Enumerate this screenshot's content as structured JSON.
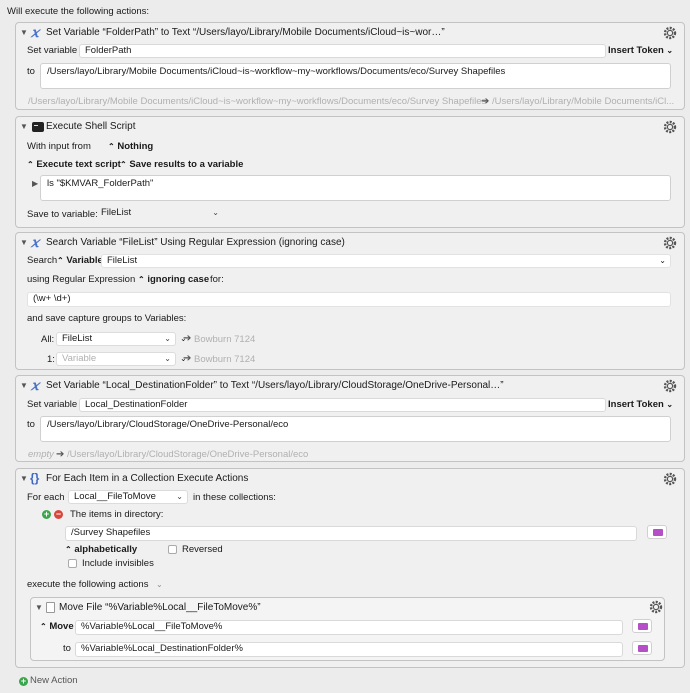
{
  "header": {
    "title": "Will execute the following actions:"
  },
  "a1": {
    "title": "Set Variable “FolderPath” to Text “/Users/layo/Library/Mobile Documents/iCloud~is~wor…”",
    "set_label": "Set variable",
    "var_name": "FolderPath",
    "insert_token": "Insert Token",
    "to_label": "to",
    "value": "/Users/layo/Library/Mobile Documents/iCloud~is~workflow~my~workflows/Documents/eco/Survey Shapefiles",
    "preview_left": "/Users/layo/Library/Mobile Documents/iCloud~is~workflow~my~workflows/Documents/eco/Survey Shapefiles",
    "preview_arrow": "➔",
    "preview_right": "/Users/layo/Library/Mobile Documents/iCl..."
  },
  "a2": {
    "title": "Execute Shell Script",
    "with_input": "With input from",
    "input_value": "Nothing",
    "exec_mode": "Execute text script",
    "save_mode": "Save results to a variable",
    "script": "ls \"$KMVAR_FolderPath\"",
    "save_to_label": "Save to variable:",
    "save_to_value": "FileList"
  },
  "a3": {
    "title": "Search Variable “FileList” Using Regular Expression (ignoring case)",
    "search_label": "Search",
    "search_type": "Variable",
    "search_var": "FileList",
    "using_label": "using Regular Expression",
    "case_mode": "ignoring case",
    "for_label": "for:",
    "regex": "(\\w+ \\d+)",
    "capture_label": "and save capture groups to Variables:",
    "all_label": "All:",
    "all_value": "FileList",
    "all_preview": "Bowburn 7124",
    "g1_label": "1:",
    "g1_placeholder": "Variable",
    "g1_preview": "Bowburn 7124",
    "preview_arrow": "➔"
  },
  "a4": {
    "title": "Set Variable “Local_DestinationFolder” to Text “/Users/layo/Library/CloudStorage/OneDrive-Personal…”",
    "set_label": "Set variable",
    "var_name": "Local_DestinationFolder",
    "insert_token": "Insert Token",
    "to_label": "to",
    "value": "/Users/layo/Library/CloudStorage/OneDrive-Personal/eco",
    "preview_left": "empty",
    "preview_arrow": "➔",
    "preview_right": "/Users/layo/Library/CloudStorage/OneDrive-Personal/eco"
  },
  "a5": {
    "title": "For Each Item in a Collection Execute Actions",
    "for_each_label": "For each",
    "for_each_var": "Local__FileToMove",
    "collections_label": "in these collections:",
    "items_label": "The items in directory:",
    "directory": "/Survey Shapefiles",
    "sort_mode": "alphabetically",
    "reversed_label": "Reversed",
    "include_invisibles": "Include invisibles",
    "execute_label": "execute the following actions",
    "move": {
      "title": "Move File “%Variable%Local__FileToMove%”",
      "mode": "Move",
      "source": "%Variable%Local__FileToMove%",
      "to_label": "to",
      "dest": "%Variable%Local_DestinationFolder%"
    }
  },
  "footer": {
    "new_action": "New Action"
  },
  "colors": {
    "accent": "#4a74c9",
    "folder": "#b44fc7",
    "add": "#3aa64b",
    "remove": "#d9463c"
  }
}
